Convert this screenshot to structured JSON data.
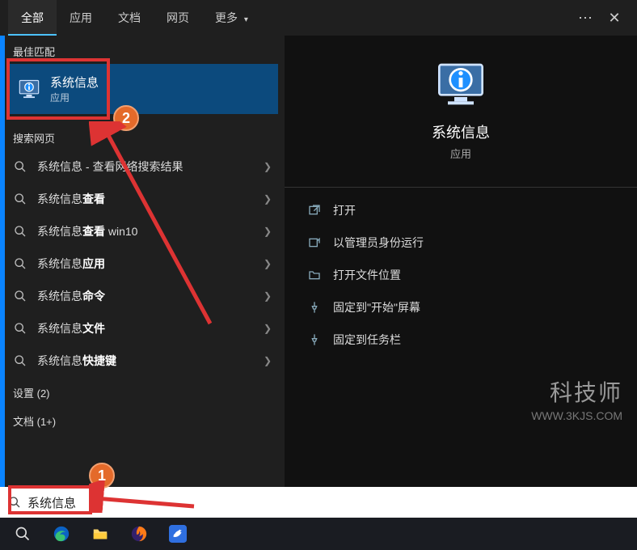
{
  "topbar": {
    "tabs": [
      "全部",
      "应用",
      "文档",
      "网页",
      "更多"
    ],
    "active_tab_index": 0,
    "more_glyph": "⋯",
    "close_glyph": "✕"
  },
  "left": {
    "best_match_label": "最佳匹配",
    "best_match": {
      "title": "系统信息",
      "subtitle": "应用"
    },
    "web_label": "搜索网页",
    "web_items": [
      {
        "prefix": "系统信息",
        "suffix": " - 查看网络搜索结果",
        "bold": ""
      },
      {
        "prefix": "系统信息",
        "suffix": "",
        "bold": "查看"
      },
      {
        "prefix": "系统信息",
        "suffix": " win10",
        "bold": "查看"
      },
      {
        "prefix": "系统信息",
        "suffix": "",
        "bold": "应用"
      },
      {
        "prefix": "系统信息",
        "suffix": "",
        "bold": "命令"
      },
      {
        "prefix": "系统信息",
        "suffix": "",
        "bold": "文件"
      },
      {
        "prefix": "系统信息",
        "suffix": "",
        "bold": "快捷键"
      }
    ],
    "settings_label": "设置 (2)",
    "docs_label": "文档 (1+)"
  },
  "right": {
    "title": "系统信息",
    "subtitle": "应用",
    "actions": [
      {
        "icon": "open",
        "label": "打开"
      },
      {
        "icon": "admin",
        "label": "以管理员身份运行"
      },
      {
        "icon": "folder",
        "label": "打开文件位置"
      },
      {
        "icon": "pinstart",
        "label": "固定到\"开始\"屏幕"
      },
      {
        "icon": "pintask",
        "label": "固定到任务栏"
      }
    ]
  },
  "search": {
    "value": "系统信息",
    "icon": "search"
  },
  "taskbar": {
    "items": [
      "search",
      "edge",
      "explorer",
      "firefox",
      "bird"
    ]
  },
  "annotations": {
    "badge1": "1",
    "badge2": "2"
  },
  "watermark": {
    "line1": "科技师",
    "line2": "WWW.3KJS.COM"
  }
}
